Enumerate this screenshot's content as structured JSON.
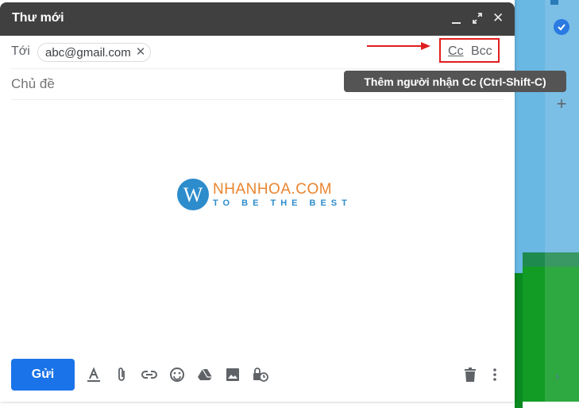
{
  "compose": {
    "title": "Thư mới",
    "to_label": "Tới",
    "recipient": "abc@gmail.com",
    "subject_placeholder": "Chủ đề",
    "cc_label": "Cc",
    "bcc_label": "Bcc",
    "tooltip": "Thêm người nhận Cc (Ctrl-Shift-C)",
    "send_label": "Gửi"
  },
  "watermark": {
    "brand": "NHANHOA.COM",
    "slogan": "TO BE THE BEST"
  },
  "colors": {
    "titlebar": "#404040",
    "send_button": "#1a73e8",
    "highlight_box": "#e01e1e",
    "tooltip_bg": "#545454"
  },
  "icons": [
    "minimize-icon",
    "expand-icon",
    "close-icon",
    "remove-recipient-icon",
    "formatting-icon",
    "attach-icon",
    "link-icon",
    "emoji-icon",
    "drive-icon",
    "photo-icon",
    "confidential-icon",
    "trash-icon",
    "more-options-icon",
    "tasks-icon",
    "add-icon"
  ]
}
